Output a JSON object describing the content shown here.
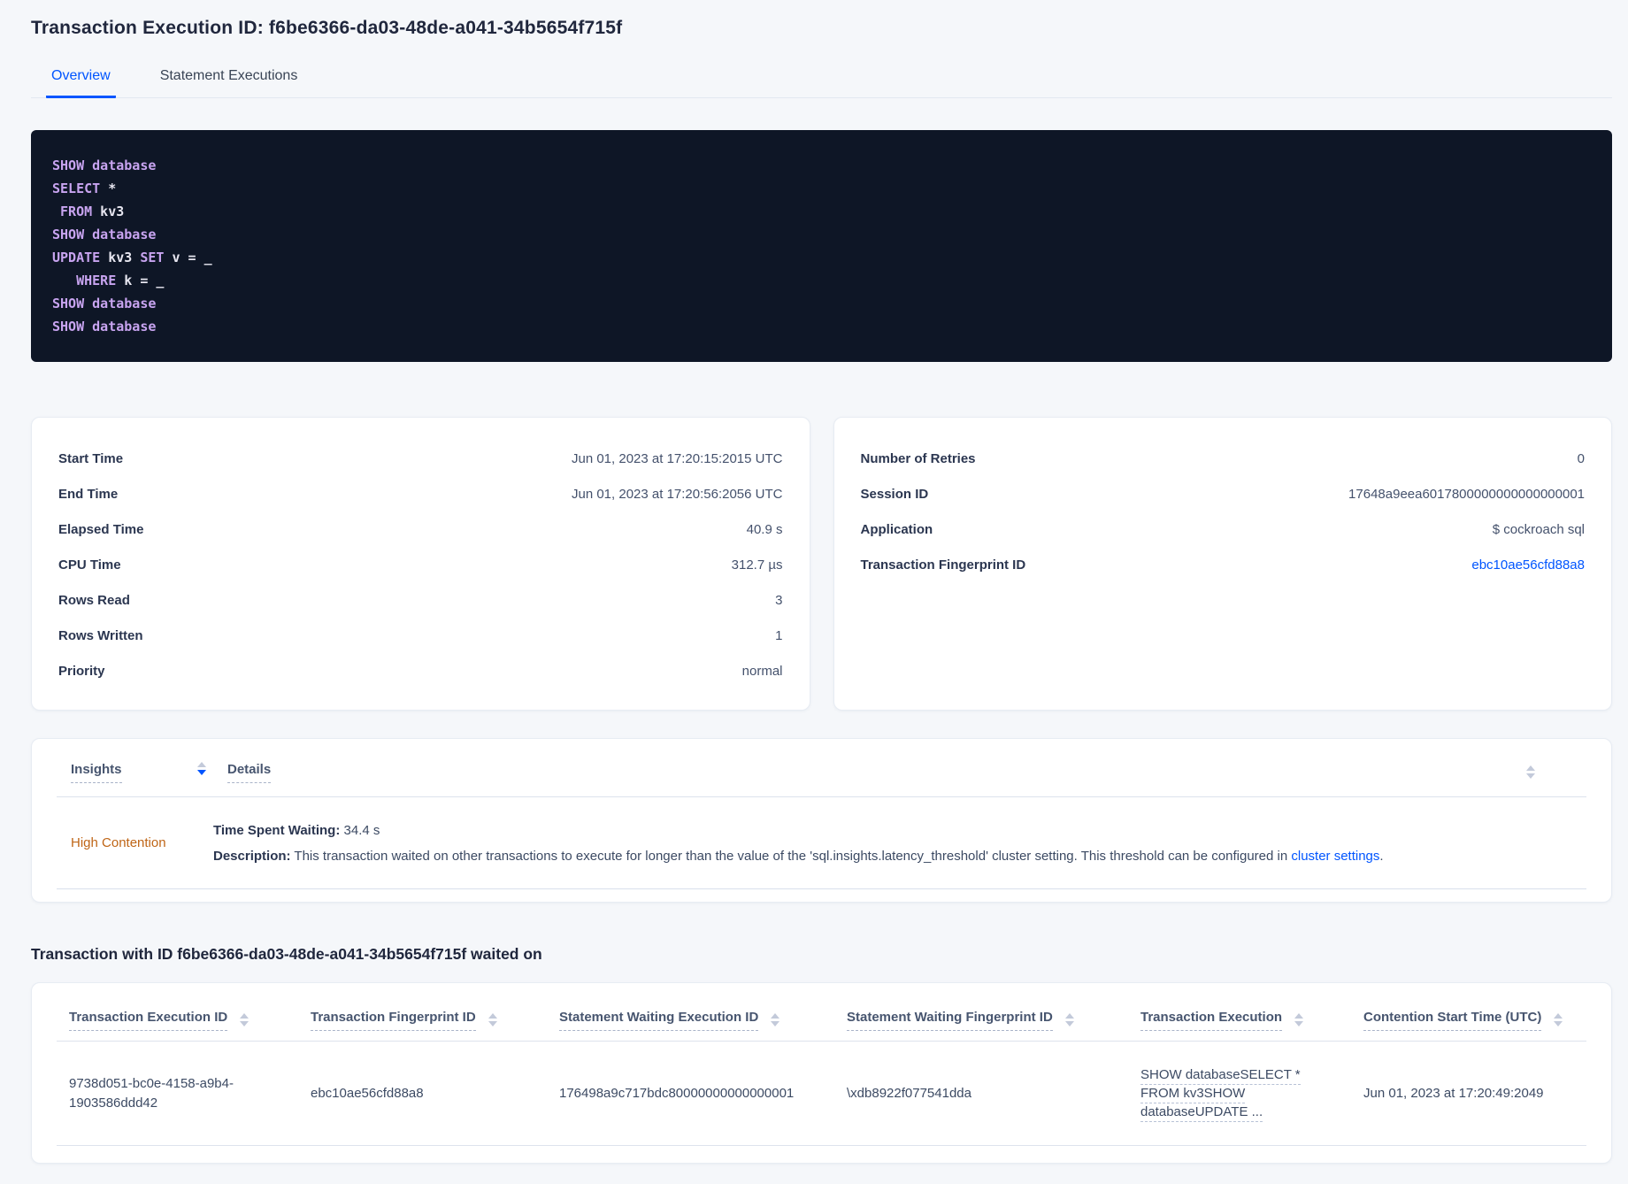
{
  "page": {
    "title": "Transaction Execution ID: f6be6366-da03-48de-a041-34b5654f715f"
  },
  "tabs": [
    {
      "label": "Overview",
      "active": true
    },
    {
      "label": "Statement Executions",
      "active": false
    }
  ],
  "sql": {
    "lines": [
      [
        {
          "t": "kw",
          "s": "SHOW database"
        }
      ],
      [
        {
          "t": "kw",
          "s": "SELECT"
        },
        {
          "t": "id",
          "s": " *"
        }
      ],
      [
        {
          "t": "kw",
          "s": " FROM"
        },
        {
          "t": "id",
          "s": " kv3"
        }
      ],
      [
        {
          "t": "kw",
          "s": "SHOW database"
        }
      ],
      [
        {
          "t": "kw",
          "s": "UPDATE"
        },
        {
          "t": "id",
          "s": " kv3 "
        },
        {
          "t": "kw",
          "s": "SET"
        },
        {
          "t": "id",
          "s": " v = _"
        }
      ],
      [
        {
          "t": "kw",
          "s": "   WHERE"
        },
        {
          "t": "id",
          "s": " k = _"
        }
      ],
      [
        {
          "t": "kw",
          "s": "SHOW database"
        }
      ],
      [
        {
          "t": "kw",
          "s": "SHOW database"
        }
      ]
    ]
  },
  "details_left": {
    "rows": [
      {
        "label": "Start Time",
        "value": "Jun 01, 2023 at 17:20:15:2015 UTC"
      },
      {
        "label": "End Time",
        "value": "Jun 01, 2023 at 17:20:56:2056 UTC"
      },
      {
        "label": "Elapsed Time",
        "value": "40.9 s"
      },
      {
        "label": "CPU Time",
        "value": "312.7 µs"
      },
      {
        "label": "Rows Read",
        "value": "3"
      },
      {
        "label": "Rows Written",
        "value": "1"
      },
      {
        "label": "Priority",
        "value": "normal"
      }
    ]
  },
  "details_right": {
    "rows": [
      {
        "label": "Number of Retries",
        "value": "0"
      },
      {
        "label": "Session ID",
        "value": "17648a9eea6017800000000000000001"
      },
      {
        "label": "Application",
        "value": "$ cockroach sql"
      },
      {
        "label": "Transaction Fingerprint ID",
        "value": "ebc10ae56cfd88a8",
        "link": true
      }
    ]
  },
  "insights_table": {
    "columns": [
      {
        "label": "Insights"
      },
      {
        "label": "Details"
      }
    ],
    "row": {
      "insight": "High Contention",
      "waiting_label": "Time Spent Waiting:",
      "waiting_value": " 34.4 s",
      "description_label": "Description:",
      "description_text": " This transaction waited on other transactions to execute for longer than the value of the 'sql.insights.latency_threshold' cluster setting. This threshold can be configured in ",
      "description_link": "cluster settings",
      "description_end": "."
    }
  },
  "waited_section": {
    "heading": "Transaction with ID f6be6366-da03-48de-a041-34b5654f715f waited on",
    "columns": [
      {
        "label": "Transaction Execution ID"
      },
      {
        "label": "Transaction Fingerprint ID"
      },
      {
        "label": "Statement Waiting Execution ID"
      },
      {
        "label": "Statement Waiting Fingerprint ID"
      },
      {
        "label": "Transaction Execution"
      },
      {
        "label": "Contention Start Time (UTC)"
      }
    ],
    "row": {
      "txn_exec_id": "9738d051-bc0e-4158-a9b4-1903586ddd42",
      "txn_fingerprint_id": "ebc10ae56cfd88a8",
      "stmt_waiting_exec_id": "176498a9c717bdc80000000000000001",
      "stmt_waiting_fingerprint_id": "\\xdb8922f077541dda",
      "txn_execution_lines": [
        "SHOW databaseSELECT *",
        "FROM kv3SHOW",
        "databaseUPDATE ..."
      ],
      "contention_start": "Jun 01, 2023 at 17:20:49:2049"
    }
  },
  "colors": {
    "accent_blue": "#0055ff",
    "insight_warning_orange": "#bf6516",
    "sql_keyword_purple": "#c8a4f0",
    "sql_box_background": "#0e1626",
    "page_background": "#f5f7fa"
  }
}
